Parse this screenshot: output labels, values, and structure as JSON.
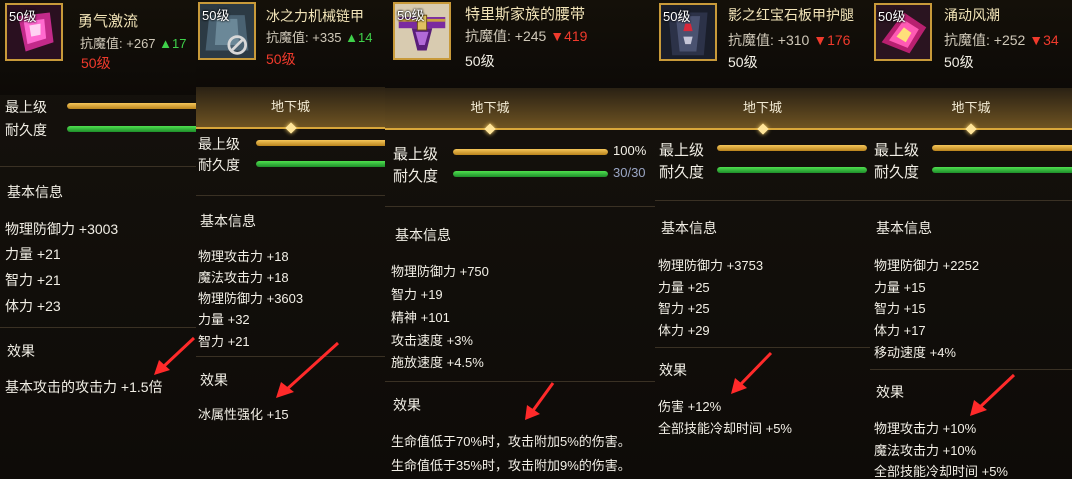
{
  "panels": [
    {
      "level_badge": "50级",
      "name": "勇气激流",
      "resist_label": "抗魔值:",
      "resist_value": "+267",
      "resist_delta": "▲17",
      "level_text": "50级",
      "bars": [
        {
          "label": "最上级",
          "value": "",
          "fill": 1.0
        },
        {
          "label": "耐久度",
          "value": "",
          "fill": 1.0
        }
      ],
      "basic_title": "基本信息",
      "basic": [
        "物理防御力 +3003",
        "力量 +21",
        "智力 +21",
        "体力 +23"
      ],
      "effect_title": "效果",
      "effects": [
        "基本攻击的攻击力 +1.5倍"
      ]
    },
    {
      "level_badge": "50级",
      "name": "冰之力机械链甲",
      "resist_label": "抗魔值:",
      "resist_value": "+335",
      "resist_delta": "▲14",
      "level_text": "50级",
      "dungeon": "地下城",
      "bars": [
        {
          "label": "最上级",
          "value": "",
          "fill": 1.0
        },
        {
          "label": "耐久度",
          "value": "",
          "fill": 1.0
        }
      ],
      "basic_title": "基本信息",
      "basic": [
        "物理攻击力 +18",
        "魔法攻击力 +18",
        "物理防御力 +3603",
        "力量 +32",
        "智力 +21"
      ],
      "effect_title": "效果",
      "effects": [
        "冰属性强化 +15"
      ]
    },
    {
      "level_badge": "50级",
      "name": "特里斯家族的腰带",
      "resist_label": "抗魔值:",
      "resist_value": "+245",
      "resist_delta": "▼419",
      "level_text": "50级",
      "dungeon": "地下城",
      "bars": [
        {
          "label": "最上级",
          "value": "100%",
          "fill": 1.0
        },
        {
          "label": "耐久度",
          "value": "30/30",
          "fill": 1.0
        }
      ],
      "basic_title": "基本信息",
      "basic": [
        "物理防御力 +750",
        "智力 +19",
        "精神 +101",
        "攻击速度 +3%",
        "施放速度 +4.5%"
      ],
      "effect_title": "效果",
      "effects": [
        "生命值低于70%时，攻击附加5%的伤害。",
        "生命值低于35%时，攻击附加9%的伤害。"
      ]
    },
    {
      "level_badge": "50级",
      "name": "影之红宝石板甲护腿",
      "resist_label": "抗魔值:",
      "resist_value": "+310",
      "resist_delta": "▼176",
      "level_text": "50级",
      "dungeon": "地下城",
      "bars": [
        {
          "label": "最上级",
          "value": "",
          "fill": 1.0
        },
        {
          "label": "耐久度",
          "value": "",
          "fill": 1.0
        }
      ],
      "basic_title": "基本信息",
      "basic": [
        "物理防御力 +3753",
        "力量 +25",
        "智力 +25",
        "体力 +29"
      ],
      "effect_title": "效果",
      "effects": [
        "伤害 +12%",
        "全部技能冷却时间 +5%"
      ]
    },
    {
      "level_badge": "50级",
      "name": "涌动风潮",
      "resist_label": "抗魔值:",
      "resist_value": "+252",
      "resist_delta": "▼34",
      "level_text": "50级",
      "dungeon": "地下城",
      "bars": [
        {
          "label": "最上级",
          "value": "",
          "fill": 1.0
        },
        {
          "label": "耐久度",
          "value": "",
          "fill": 1.0
        }
      ],
      "basic_title": "基本信息",
      "basic": [
        "物理防御力 +2252",
        "力量 +15",
        "智力 +15",
        "体力 +17",
        "移动速度 +4%"
      ],
      "effect_title": "效果",
      "effects": [
        "物理攻击力 +10%",
        "魔法攻击力 +10%",
        "全部技能冷却时间 +5%"
      ]
    }
  ],
  "colors": {
    "gold": "#c89a3a",
    "red_arrow": "#ff2a2a",
    "up": "#3fd14a",
    "down": "#f03a2c"
  }
}
